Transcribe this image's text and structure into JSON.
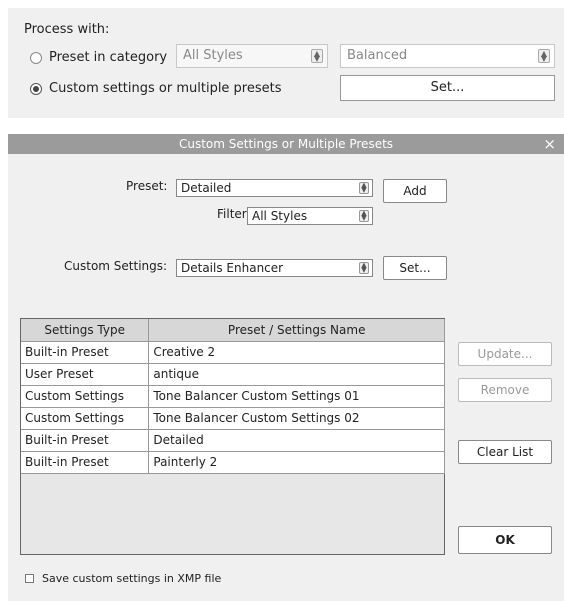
{
  "process": {
    "label": "Process with:",
    "option1": "Preset in category",
    "option2": "Custom settings or multiple presets",
    "category_select": "All Styles",
    "preset_select": "Balanced",
    "set_button": "Set..."
  },
  "dialog": {
    "title": "Custom Settings or Multiple Presets",
    "close": "×",
    "preset_label": "Preset:",
    "preset_value": "Detailed",
    "add_button": "Add",
    "filter_label": "Filter",
    "filter_value": "All Styles",
    "custom_label": "Custom Settings:",
    "custom_value": "Details Enhancer",
    "set_button": "Set...",
    "table": {
      "headers": [
        "Settings Type",
        "Preset / Settings Name"
      ],
      "rows": [
        [
          "Built-in Preset",
          "Creative 2"
        ],
        [
          "User Preset",
          "antique"
        ],
        [
          "Custom Settings",
          "Tone Balancer Custom Settings 01"
        ],
        [
          "Custom Settings",
          "Tone Balancer Custom Settings 02"
        ],
        [
          "Built-in Preset",
          "Detailed"
        ],
        [
          "Built-in Preset",
          "Painterly 2"
        ]
      ]
    },
    "update_button": "Update...",
    "remove_button": "Remove",
    "clear_button": "Clear List",
    "ok_button": "OK",
    "save_checkbox_label": "Save custom settings in XMP file"
  }
}
